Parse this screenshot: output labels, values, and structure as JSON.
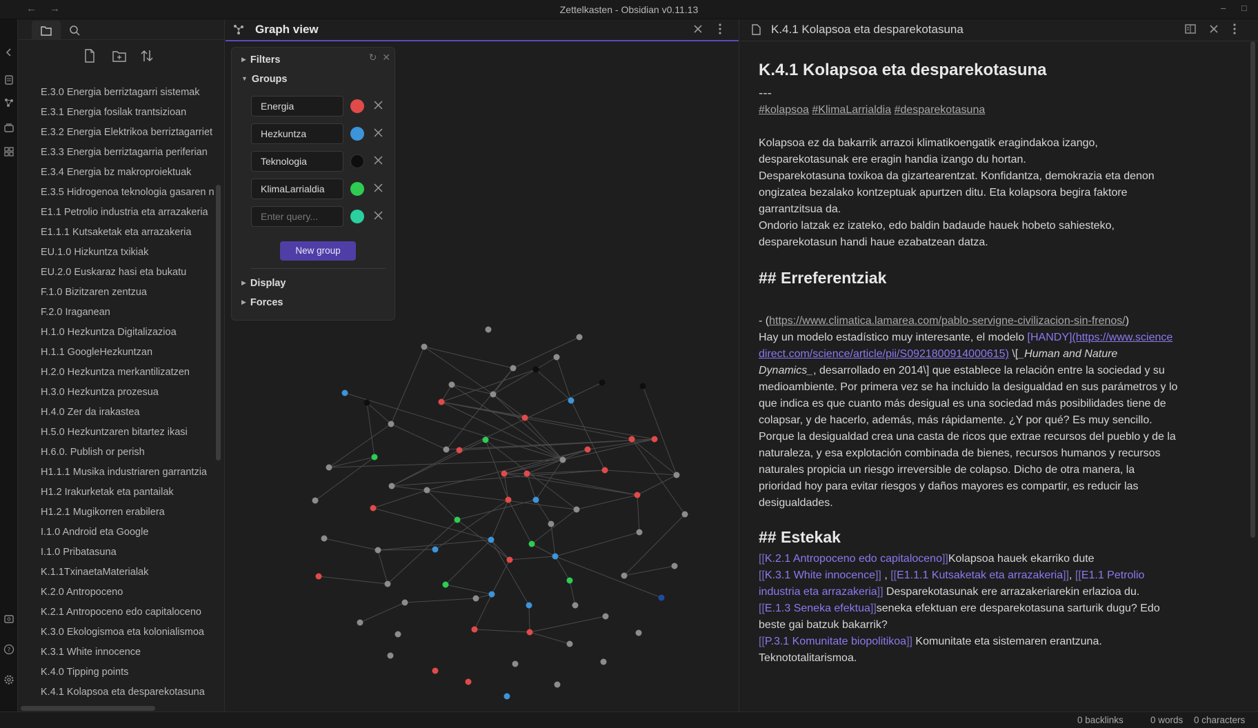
{
  "window": {
    "title": "Zettelkasten - Obsidian v0.11.13",
    "back_icon": "←",
    "forward_icon": "→",
    "minimize": "–",
    "maximize": "□"
  },
  "explorer": {
    "files": [
      "E.3.0 Energia berriztagarri sistemak",
      "E.3.1 Energia fosilak trantsizioan",
      "E.3.2 Energia Elektrikoa berriztagarriet",
      "E.3.3 Energia berriztagarria periferian",
      "E.3.4 Energia bz makroproiektuak",
      "E.3.5 Hidrogenoa teknologia gasaren n",
      "E1.1 Petrolio industria eta arrazakeria",
      "E1.1.1 Kutsaketak eta arrazakeria",
      "EU.1.0 Hizkuntza txikiak",
      "EU.2.0 Euskaraz hasi eta bukatu",
      "F.1.0 Bizitzaren zentzua",
      "F.2.0 Iraganean",
      "H.1.0 Hezkuntza Digitalizazioa",
      "H.1.1 GoogleHezkuntzan",
      "H.2.0 Hezkuntza merkantilizatzen",
      "H.3.0 Hezkuntza prozesua",
      "H.4.0 Zer da irakastea",
      "H.5.0 Hezkuntzaren bitartez ikasi",
      "H.6.0. Publish or perish",
      "H1.1.1 Musika industriaren garrantzia",
      "H1.2 Irakurketak eta pantailak",
      "H1.2.1 Mugikorren erabilera",
      "I.1.0 Android eta Google",
      "I.1.0 Pribatasuna",
      "K.1.1TxinaetaMaterialak",
      "K.2.0 Antropoceno",
      "K.2.1 Antropoceno edo capitaloceno",
      "K.3.0 Ekologismoa eta kolonialismoa",
      "K.3.1 White innocence",
      "K.4.0 Tipping points",
      "K.4.1 Kolapsoa eta desparekotasuna"
    ]
  },
  "graph": {
    "title": "Graph view",
    "controls": {
      "filters": "Filters",
      "groups": "Groups",
      "display": "Display",
      "forces": "Forces",
      "new_group": "New group",
      "query_placeholder": "Enter query...",
      "group_list": [
        {
          "query": "Energia",
          "color": "#e24a4a"
        },
        {
          "query": "Hezkuntza",
          "color": "#3d94d8"
        },
        {
          "query": "Teknologia",
          "color": "#0e0e0e"
        },
        {
          "query": "KlimaLarrialdia",
          "color": "#2ecc52"
        },
        {
          "query": "",
          "color": "#2ccf9f"
        }
      ]
    },
    "node_colors": {
      "default": "#8c8c8c",
      "energia": "#e24a4a",
      "hezkuntza": "#3d94d8",
      "teknologia": "#0e0e0e",
      "klima": "#2ecc52",
      "navy": "#1f4aa0"
    }
  },
  "editor": {
    "tab_title": "K.4.1 Kolapsoa eta desparekotasuna",
    "heading": "K.4.1 Kolapsoa eta desparekotasuna",
    "hr": "---",
    "tags": [
      "#kolapsoa",
      "#KlimaLarrialdia",
      "#desparekotasuna"
    ],
    "intro_lines": [
      "Kolapsoa ez da bakarrik arrazoi klimatikoengatik eragindakoa izango,",
      "desparekotasunak ere eragin handia izango du hortan.",
      "Desparekotasuna toxikoa da gizartearentzat. Konfidantza, demokrazia eta denon",
      "ongizatea bezalako kontzeptuak apurtzen ditu. Eta kolapsora begira faktore",
      "garrantzitsua da.",
      "Ondorio latzak ez izateko, edo baldin badaude hauek hobeto sahiesteko,",
      "desparekotasun handi haue ezabatzean datza."
    ],
    "refs_heading": "## Erreferentziak",
    "ref": {
      "prefix": "- (",
      "url": "https://www.climatica.lamarea.com/pablo-servigne-civilizacion-sin-frenos/",
      "suffix": ")",
      "line1_a": "Hay un modelo estadístico muy interesante, el modelo ",
      "handy": "[HANDY]",
      "handy_url_1": "(https://www.science",
      "handy_url_2": "direct.com/science/article/pii/S0921800914000615)",
      "line2_b": " \\[",
      "line2_ital": "_Human and Nature",
      "line3_ital": "Dynamics_",
      "line3_rest": ", desarrollado en 2014\\] que establece la relación entre la sociedad y su",
      "rest_lines": [
        "medioambiente. Por primera vez se ha incluido la desigualdad en sus parámetros y lo",
        "que indica es que cuanto más desigual es una sociedad más posibilidades tiene de",
        "colapsar, y de hacerlo, además, más rápidamente. ¿Y por qué? Es muy sencillo.",
        "Porque la desigualdad crea una casta de ricos que extrae recursos del pueblo y de la",
        "naturaleza, y esa explotación combinada de bienes, recursos humanos y recursos",
        "naturales propicia un riesgo irreversible de colapso. Dicho de otra manera, la",
        "prioridad hoy para evitar riesgos y daños mayores es compartir, es reducir las",
        "desigualdades."
      ]
    },
    "links_heading": "## Estekak",
    "links": {
      "l1_link": "K.2.1 Antropoceno edo capitaloceno",
      "l1_text": "Kolapsoa hauek ekarriko dute",
      "l2_link_a": "K.3.1 White innocence",
      "l2_sep": " , ",
      "l2_link_b": "E1.1.1 Kutsaketak eta arrazakeria",
      "l2_sep2": ", ",
      "l2_link_c_1": "E1.1 Petrolio",
      "l2_link_c_2": "industria eta arrazakeria",
      "l2_text": " Desparekotasunak ere arrazakeriarekin erlazioa du.",
      "l3_link": "E.1.3 Seneka efektua",
      "l3_text_1": "seneka efektuan ere desparekotasuna sarturik dugu? Edo",
      "l3_text_2": "beste gai batzuk bakarrik?",
      "l4_link": "P.3.1 Komunitate biopolitikoa",
      "l4_text_1": " Komunitate eta sistemaren erantzuna.",
      "l4_text_2": "Teknototalitarismoa."
    }
  },
  "status": {
    "backlinks": "0 backlinks",
    "words": "0 words",
    "characters": "0 characters"
  }
}
